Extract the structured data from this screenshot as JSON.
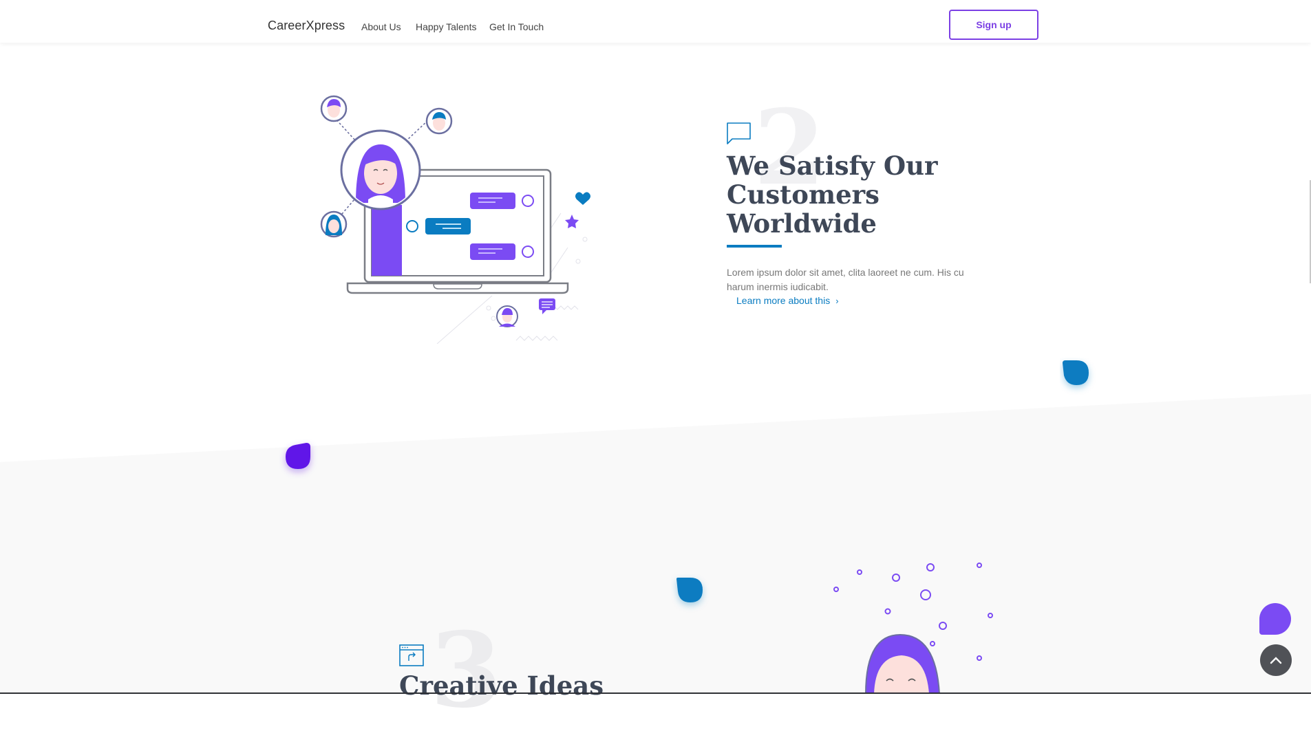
{
  "header": {
    "brand": "CareerXpress",
    "nav": [
      {
        "label": "About Us"
      },
      {
        "label": "Happy Talents"
      },
      {
        "label": "Get In Touch"
      }
    ],
    "signup_label": "Sign up"
  },
  "feature": {
    "number": "2",
    "title": "We Satisfy Our Customers Worldwide",
    "text": "Lorem ipsum dolor sit amet, clita laoreet ne cum. His cu harum inermis iudicabit.",
    "link_label": "Learn more about this",
    "icon": "chat-bubble-icon"
  },
  "feature_next": {
    "number": "3",
    "title": "Creative Ideas",
    "icon": "browser-window-icon"
  },
  "colors": {
    "accent_purple": "#7b3fe4",
    "accent_blue": "#0a7cc1",
    "heading": "#3e4757",
    "band_gray": "#f9f9f9"
  },
  "fabs": {
    "chat_icon": "chat-bubble-icon",
    "top_icon": "chevron-up-icon"
  }
}
